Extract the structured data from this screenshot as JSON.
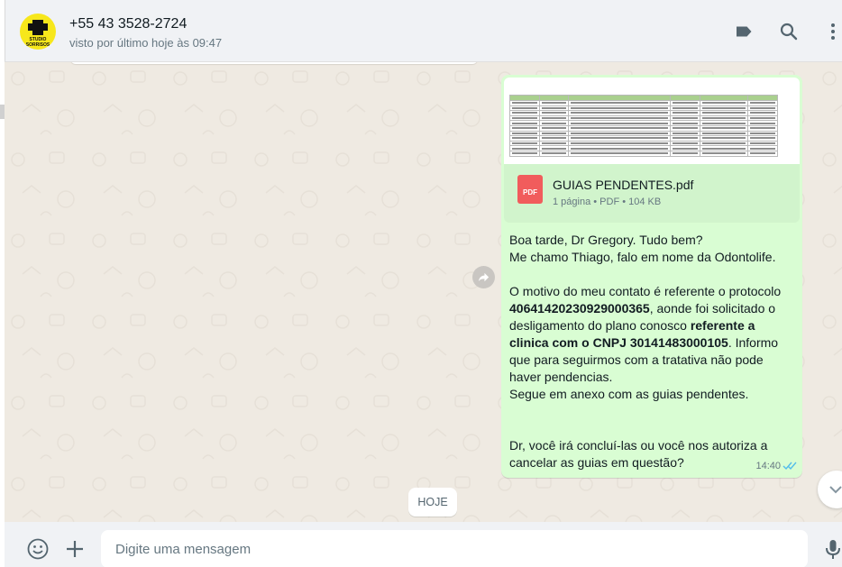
{
  "header": {
    "contact_name": "+55 43 3528-2724",
    "status": "visto por último hoje às 09:47",
    "avatar_text": "STUDIO SORRISOS",
    "icons": [
      "label-icon",
      "search-icon",
      "menu-dots-icon"
    ]
  },
  "message": {
    "document": {
      "file_name": "GUIAS PENDENTES.pdf",
      "meta": "1 página • PDF • 104 KB",
      "type_label": "PDF"
    },
    "greeting_1": "Boa tarde, Dr Gregory. Tudo bem?",
    "greeting_2": "Me chamo Thiago, falo em nome da Odontolife.",
    "p1_a": "O motivo do meu contato é referente o protocolo ",
    "p1_protocol": "40641420230929000365",
    "p1_b": ", aonde foi solicitado o desligamento do plano conosco ",
    "p1_bold": "referente a clinica com o CNPJ 30141483000105",
    "p1_c": ". Informo que para seguirmos com a tratativa não pode haver pendencias.",
    "p1_d": "Segue em anexo com as guias pendentes.",
    "p2": "Dr, você irá concluí-las ou você nos autoriza a cancelar as guias em questão?",
    "time": "14:40",
    "read_status": "read"
  },
  "day_divider": "HOJE",
  "composer": {
    "placeholder": "Digite uma mensagem"
  },
  "colors": {
    "outgoing_bubble": "#d9fdd3",
    "panel_bg": "#f0f2f5",
    "chat_bg": "#efeae2",
    "read_ticks": "#53bdeb",
    "pdf_red": "#f15c5c"
  }
}
